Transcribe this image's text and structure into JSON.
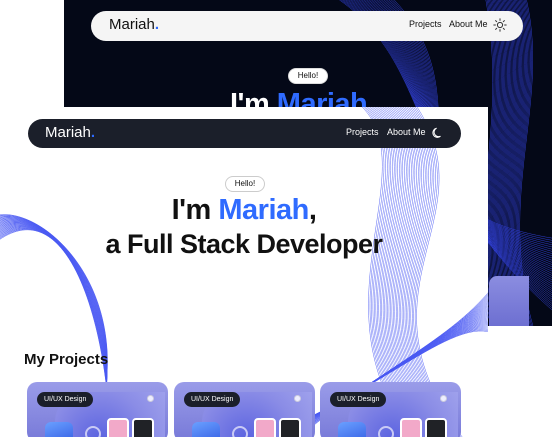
{
  "dark_preview": {
    "logo": "Mariah",
    "logo_dot": ".",
    "nav": {
      "projects": "Projects",
      "about": "About Me"
    },
    "theme_icon": "sun-icon",
    "hello": "Hello!",
    "headline_prefix": "I'm ",
    "headline_name": "Mariah"
  },
  "light_preview": {
    "logo": "Mariah",
    "logo_dot": ".",
    "nav": {
      "projects": "Projects",
      "about": "About Me"
    },
    "theme_icon": "moon-icon",
    "hello": "Hello!",
    "headline_prefix": "I'm ",
    "headline_name": "Mariah",
    "headline_comma": ",",
    "headline_line2": "a Full Stack Developer",
    "section_title": "My Projects",
    "projects": [
      {
        "tag": "UI/UX Design"
      },
      {
        "tag": "UI/UX Design"
      },
      {
        "tag": "UI/UX Design"
      }
    ]
  },
  "colors": {
    "accent": "#2f6bff",
    "dark_bg": "#040817",
    "nav_dark": "#1b1f2a",
    "card": "#8a8ce6"
  }
}
